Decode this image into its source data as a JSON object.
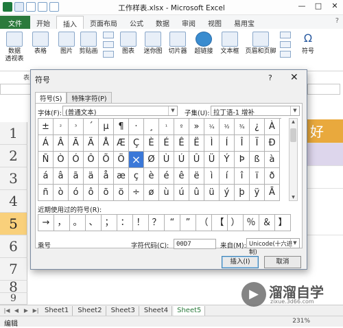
{
  "window": {
    "title": "工作样表.xlsx - Microsoft Excel",
    "controls": [
      "?",
      "—",
      "□",
      "✕"
    ]
  },
  "ribbon": {
    "tabs": [
      "文件",
      "开始",
      "插入",
      "页面布局",
      "公式",
      "数据",
      "审阅",
      "视图",
      "易用宝"
    ],
    "active_tab": "插入",
    "items": [
      "数据\n透视表",
      "表格",
      "图片",
      "剪贴画",
      "图表",
      "迷你图",
      "切片器",
      "超链接",
      "文本框",
      "页眉和页脚",
      "符号"
    ],
    "group_label": "表"
  },
  "sheet": {
    "rows": [
      "1",
      "2",
      "3",
      "4",
      "5",
      "6",
      "7",
      "8",
      "9"
    ],
    "selected_row": "5",
    "cell_text": "好"
  },
  "dialog": {
    "title": "符号",
    "help": "?",
    "close": "✕",
    "tabs": [
      "符号(S)",
      "特殊字符(P)"
    ],
    "font_label": "字体(F):",
    "font_value": "(普通文本)",
    "subset_label": "子集(U):",
    "subset_value": "拉丁语-1 增补",
    "symbols": [
      [
        "±",
        "²",
        "³",
        "´",
        "µ",
        "¶",
        "·",
        "¸",
        "¹",
        "º",
        "»",
        "¼",
        "½",
        "¾",
        "¿",
        "À"
      ],
      [
        "Á",
        "Â",
        "Ã",
        "Ä",
        "Å",
        "Æ",
        "Ç",
        "È",
        "É",
        "Ê",
        "Ë",
        "Ì",
        "Í",
        "Î",
        "Ï",
        "Ð"
      ],
      [
        "Ñ",
        "Ò",
        "Ó",
        "Ô",
        "Õ",
        "Ö",
        "×",
        "Ø",
        "Ù",
        "Ú",
        "Û",
        "Ü",
        "Ý",
        "Þ",
        "ß",
        "à"
      ],
      [
        "á",
        "â",
        "ã",
        "ä",
        "å",
        "æ",
        "ç",
        "è",
        "é",
        "ê",
        "ë",
        "ì",
        "í",
        "î",
        "ï",
        "ð"
      ],
      [
        "ñ",
        "ò",
        "ó",
        "ô",
        "õ",
        "ö",
        "÷",
        "ø",
        "ù",
        "ú",
        "û",
        "ü",
        "ý",
        "þ",
        "ÿ",
        "Ā"
      ]
    ],
    "selected_symbol": "×",
    "recent_label": "近期使用过的符号(R):",
    "recent": [
      "→",
      "，",
      "。",
      "、",
      "；",
      "：",
      "！",
      "？",
      "“",
      "”",
      "（",
      "【",
      "）",
      "％",
      "＆",
      "】"
    ],
    "char_name": "乘号",
    "char_code_label": "字符代码(C):",
    "char_code": "00D7",
    "from_label": "来自(M):",
    "from_value": "Unicode(十六进制)",
    "insert_button": "插入(I)",
    "cancel_button": "取消"
  },
  "sheet_tabs": [
    "Sheet1",
    "Sheet2",
    "Sheet3",
    "Sheet4",
    "Sheet5"
  ],
  "active_sheet": "Sheet5",
  "status": {
    "mode": "编辑",
    "zoom": "231%"
  },
  "watermark": {
    "text": "溜溜自学",
    "sub": "zixue.3d66.com"
  }
}
